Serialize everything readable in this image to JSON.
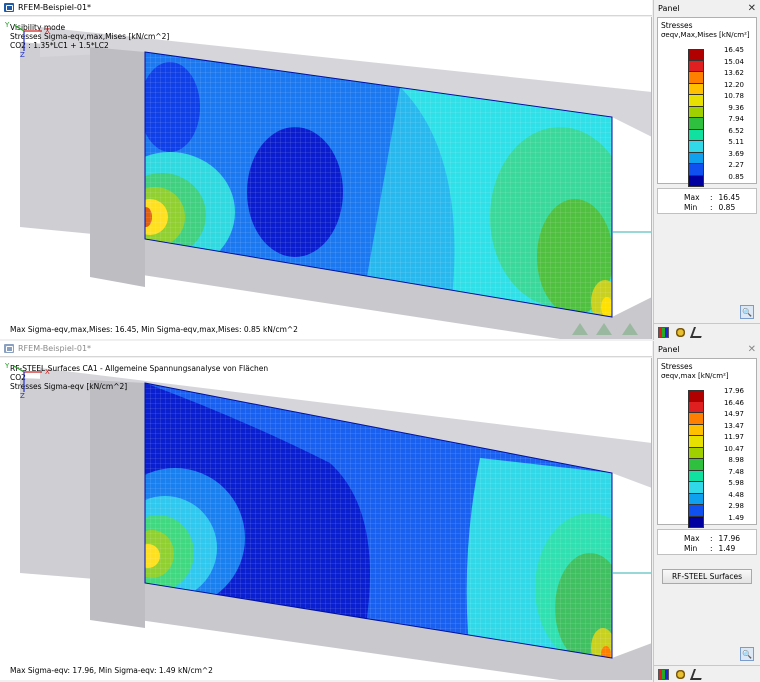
{
  "top": {
    "title": "RFEM-Beispiel-01*",
    "info_lines": [
      "Visibility mode",
      "Stresses Sigma-eqv,max,Mises [kN/cm^2]",
      "CO2 : 1.35*LC1 + 1.5*LC2"
    ],
    "status": "Max Sigma-eqv,max,Mises: 16.45, Min Sigma-eqv,max,Mises: 0.85 kN/cm^2",
    "panel_title": "Panel",
    "legend_title": "Stresses",
    "legend_sub": "σeqv,Max,Mises [kN/cm²]",
    "values": [
      "16.45",
      "15.04",
      "13.62",
      "12.20",
      "10.78",
      "9.36",
      "7.94",
      "6.52",
      "5.11",
      "3.69",
      "2.27",
      "0.85"
    ],
    "max_label": "Max",
    "max_value": "16.45",
    "min_label": "Min",
    "min_value": "0.85"
  },
  "bottom": {
    "title": "RFEM-Beispiel-01*",
    "info_lines": [
      "RF-STEEL Surfaces CA1 - Allgemeine Spannungsanalyse von Flächen",
      "CO2",
      "Stresses Sigma-eqv [kN/cm^2]"
    ],
    "status": "Max Sigma-eqv: 17.96, Min Sigma-eqv: 1.49 kN/cm^2",
    "panel_title": "Panel",
    "legend_title": "Stresses",
    "legend_sub": "σeqv,max [kN/cm²]",
    "values": [
      "17.96",
      "16.46",
      "14.97",
      "13.47",
      "11.97",
      "10.47",
      "8.98",
      "7.48",
      "5.98",
      "4.48",
      "2.98",
      "1.49"
    ],
    "max_label": "Max",
    "max_value": "17.96",
    "min_label": "Min",
    "min_value": "1.49",
    "button_label": "RF-STEEL Surfaces"
  },
  "colors": {
    "scale": [
      "#b00000",
      "#e02020",
      "#ff8000",
      "#ffc000",
      "#e8e000",
      "#a0d000",
      "#30c040",
      "#10e0a0",
      "#30d8e8",
      "#10a0f0",
      "#1050f0",
      "#0000a0"
    ]
  },
  "icons": [
    "close-icon",
    "zoom-icon",
    "color-scale-icon",
    "results-icon",
    "axes-icon"
  ],
  "axes": {
    "x": "X",
    "y": "Y",
    "z": "Z"
  }
}
